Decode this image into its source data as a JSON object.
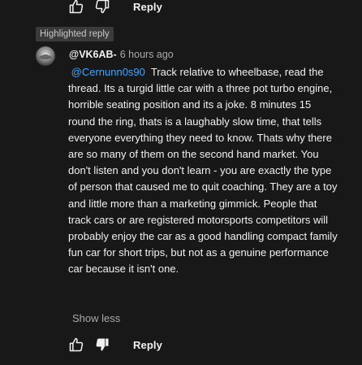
{
  "top_actions": {
    "like_icon": "thumbs-up-outline-icon",
    "dislike_icon": "thumbs-down-outline-icon",
    "reply_label": "Reply"
  },
  "highlighted_badge": "Highlighted reply",
  "comment": {
    "author": "@VK6AB-",
    "timestamp": "6 hours ago",
    "mention": "@Cernunn0s90",
    "text": "Track relative to wheelbase, read the thread.  Its a turgid little car with a three pot turbo engine, horrible seating position and its a joke.  8 minutes 15 round the ring, thats is a laughably slow time, that tells everyone everything they need to know.  Thats why there are so many of them on the second hand market.  You don't listen and you don't learn - you are exactly the type of person that caused me to quit coaching.  They are a toy and little more than a marketing gimmick.  People that track cars or are registered motorsports competitors will probably enjoy the car as a good handling compact family fun car for short trips, but not as a genuine performance car because it isn't one.",
    "show_less_label": "Show less",
    "avatar_icon": "user-avatar-icon"
  },
  "bottom_actions": {
    "like_icon": "thumbs-up-outline-icon",
    "dislike_icon": "thumbs-down-filled-icon",
    "reply_label": "Reply"
  },
  "colors": {
    "background": "#181818",
    "text": "#f1f1f1",
    "secondary_text": "#aaaaaa",
    "mention": "#3ea6ff",
    "badge_bg": "#3a3a3a"
  }
}
